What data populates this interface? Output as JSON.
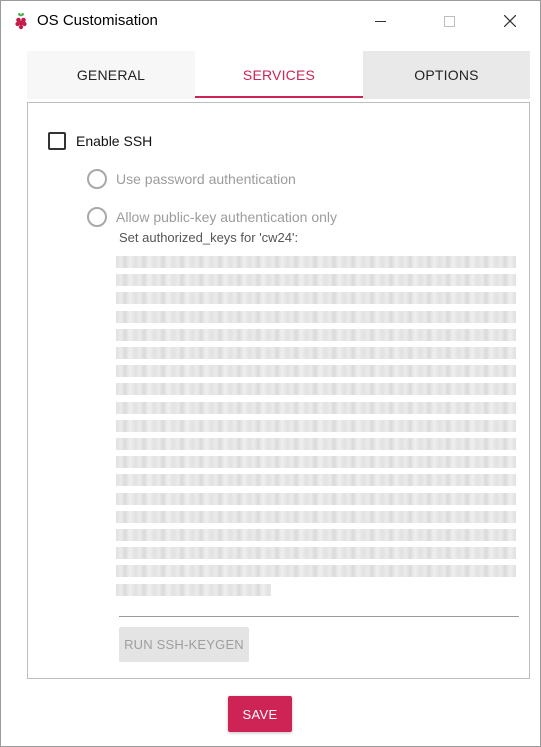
{
  "window": {
    "title": "OS Customisation",
    "icon": "raspberry-icon"
  },
  "tabs": [
    {
      "label": "GENERAL",
      "active": false
    },
    {
      "label": "SERVICES",
      "active": true
    },
    {
      "label": "OPTIONS",
      "active": false
    }
  ],
  "services": {
    "enable_ssh_label": "Enable SSH",
    "enable_ssh_checked": false,
    "password_auth_label": "Use password authentication",
    "pubkey_auth_label": "Allow public-key authentication only",
    "authorized_keys_label": "Set authorized_keys for 'cw24':",
    "run_keygen_label": "RUN SSH-KEYGEN"
  },
  "footer": {
    "save_label": "SAVE"
  },
  "colors": {
    "accent": "#cd2355",
    "disabled_text": "#9c9c9c",
    "disabled_button": "#e4e4e4"
  }
}
